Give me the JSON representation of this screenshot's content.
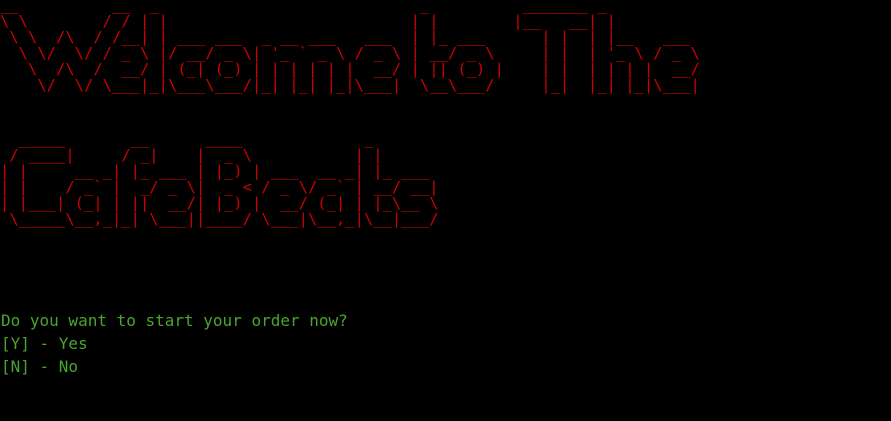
{
  "terminal": {
    "text_color": "#4aa52e",
    "banner_color": "#cc0000",
    "background": "#000000"
  },
  "banner": {
    "line1": "__          __  _                            _          _______ _\n\\ \\        / / | |                          | |        |__   __| |\n \\ \\  /\\  / /__| | ___ ___  _ __ ___   ___  | |_ ___      | |  | |__   ___\n  \\ \\/  \\/ / _ \\ |/ __/ _ \\| '_ ` _ \\ / _ \\ | __/ _ \\     | |  | '_ \\ / _ \\\n   \\  /\\  /  __/ | (_| (_) | | | | | |  __/ | || (_) |    | |  | | | |  __/\n    \\/  \\/ \\___|_|\\___\\___/|_| |_| |_|\\___|  \\__\\___/     |_|  |_| |_|\\___|",
    "line2": "  _____       __      ____             _\n / ____|     / _|    |  _ \\           | |\n| |     __ _| |_ ___ | |_) | ___  __ _| |_ ___\n| |    / _` |  _/ _ \\|  _ < / _ \\/ _` | __/ __|\n| |___| (_| | ||  __/| |_) |  __/ (_| | |_\\__ \\\n \\_____\\__,_|_| \\___||____/ \\___|\\__,_|\\__|___/"
  },
  "prompt": {
    "question": "Do you want to start your order now?",
    "option_yes": "[Y] - Yes",
    "option_no": "[N] - No"
  }
}
